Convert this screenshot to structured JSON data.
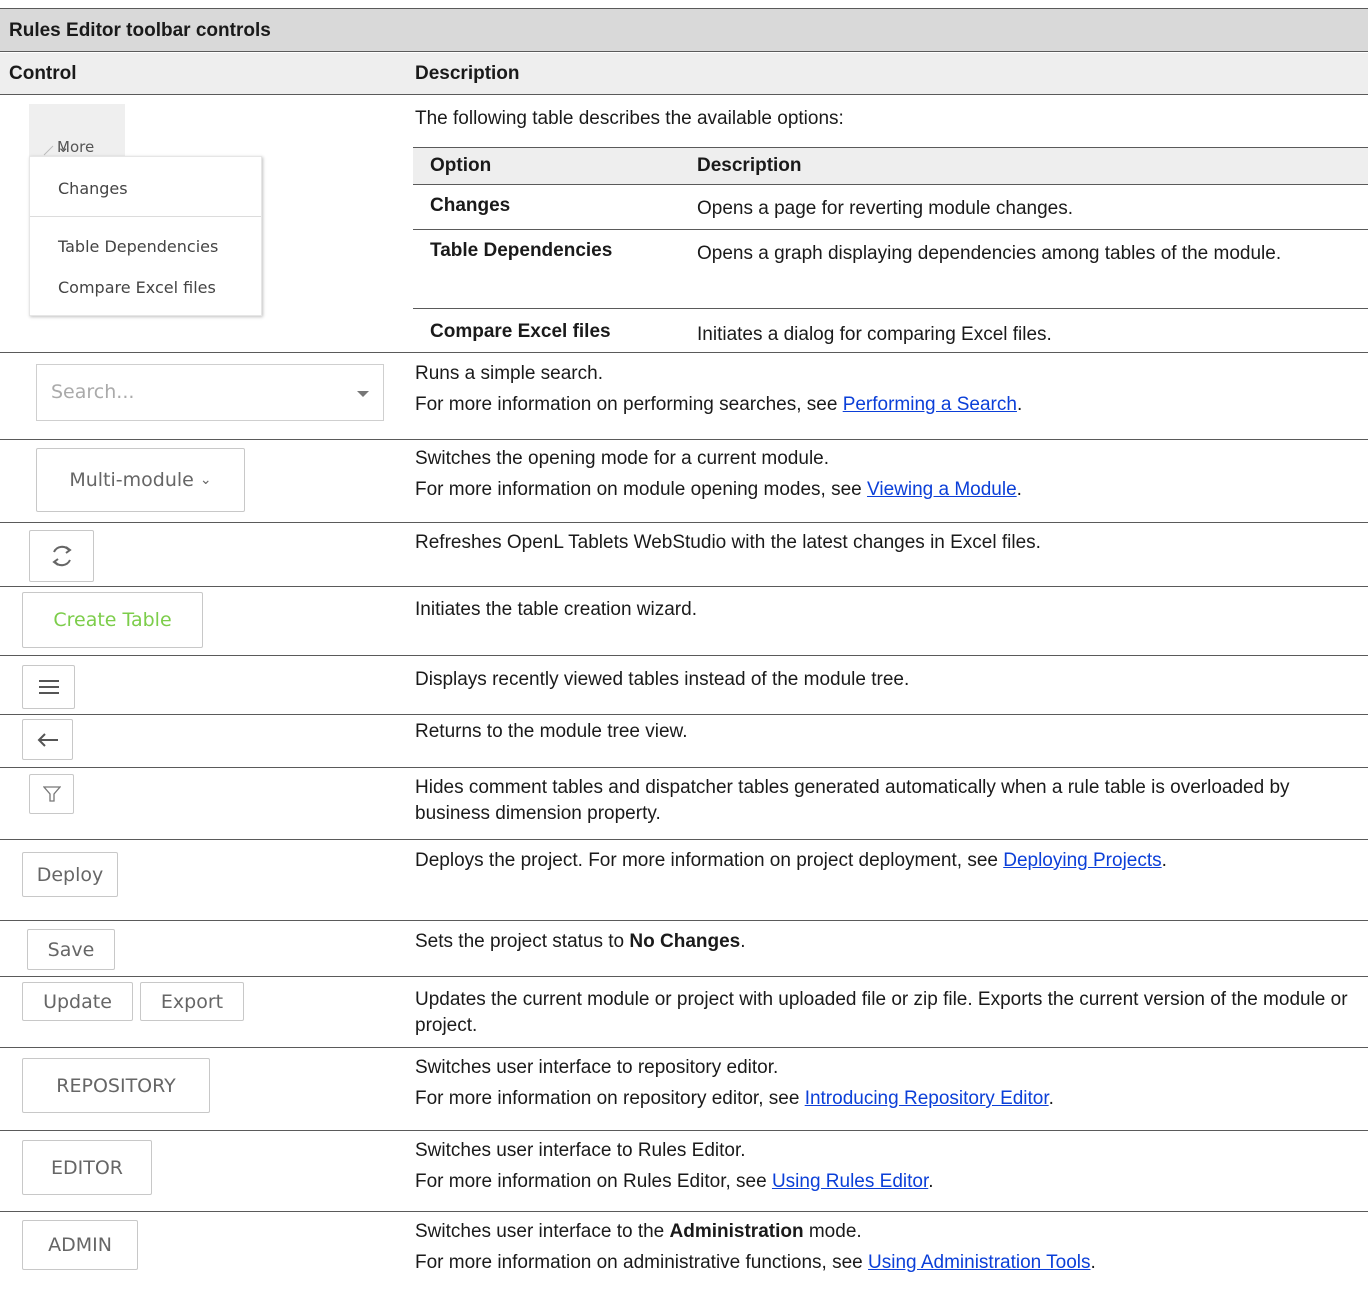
{
  "title": "Rules Editor toolbar controls",
  "header": {
    "control": "Control",
    "description": "Description"
  },
  "rows": [
    {
      "intro": "The following table describes the available options:",
      "more_button": "More",
      "menu": [
        "Changes",
        "Table Dependencies",
        "Compare Excel files"
      ],
      "options_header": {
        "option": "Option",
        "description": "Description"
      },
      "options": [
        {
          "option": "Changes",
          "description": "Opens a page for reverting module changes."
        },
        {
          "option": "Table Dependencies",
          "description": "Opens a graph displaying dependencies among tables of the module."
        },
        {
          "option": "Compare Excel files",
          "description": "Initiates a dialog for comparing Excel files."
        }
      ]
    },
    {
      "control": "Search...",
      "line1": "Runs a simple search.",
      "line2_pre": "For more information on performing searches, see ",
      "link": "Performing a Search",
      "line2_post": "."
    },
    {
      "control": "Multi-module",
      "line1": "Switches the opening mode for a current module.",
      "line2_pre": "For more information on module opening modes, see ",
      "link": "Viewing a Module",
      "line2_post": "."
    },
    {
      "control": "refresh-icon",
      "line1": "Refreshes OpenL Tablets WebStudio with the latest changes in Excel files."
    },
    {
      "control": "Create Table",
      "line1": "Initiates the table creation wizard."
    },
    {
      "control": "menu-icon",
      "line1": "Displays recently viewed tables instead of the module tree."
    },
    {
      "control": "back-arrow-icon",
      "line1": "Returns to the module tree view."
    },
    {
      "control": "filter-icon",
      "line1": "Hides comment tables and dispatcher tables generated automatically when a rule table is overloaded by business dimension property."
    },
    {
      "control": "Deploy",
      "pre": "Deploys the project. For more information on project deployment, see ",
      "link": "Deploying Projects",
      "post": "."
    },
    {
      "control": "Save",
      "pre": "Sets the project status to ",
      "bold": "No Changes",
      "post": "."
    },
    {
      "control": [
        "Update",
        "Export"
      ],
      "line1": "Updates the current module or project with uploaded file or zip file. Exports the current version of the module or project."
    },
    {
      "control": "REPOSITORY",
      "line1": "Switches user interface to repository editor.",
      "line2_pre": "For more information on repository editor, see ",
      "link": "Introducing Repository Editor",
      "line2_post": "."
    },
    {
      "control": "EDITOR",
      "line1": "Switches user interface to Rules Editor.",
      "line2_pre": "For more information on Rules Editor, see ",
      "link": "Using Rules Editor",
      "line2_post": "."
    },
    {
      "control": "ADMIN",
      "pre": "Switches user interface to the ",
      "bold": "Administration",
      "post": " mode.",
      "line2_pre": "For more information on administrative functions, see ",
      "link": "Using Administration Tools",
      "line2_post": "."
    }
  ],
  "colors": {
    "link": "#0b3fd8",
    "create_table": "#7ccd4a",
    "header_bg": "#d9d9d9",
    "subheader_bg": "#eeeeee"
  }
}
